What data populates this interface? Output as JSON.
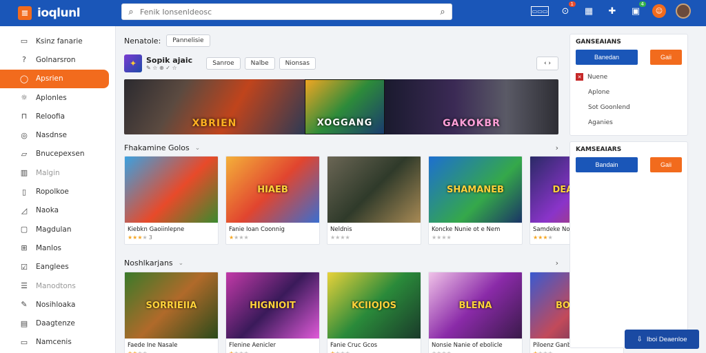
{
  "header": {
    "logo_text": "ioqlunl",
    "search_placeholder": "Fenik Ionsenldeosc",
    "box_label": "▭▭▭",
    "badge_bell": "1",
    "badge_chat": "4"
  },
  "sidebar": {
    "items": [
      {
        "label": "Ksinz fanarie",
        "icon": "map-icon"
      },
      {
        "label": "Golnarsron",
        "icon": "question-icon"
      },
      {
        "label": "Apsrien",
        "icon": "circle-icon"
      },
      {
        "label": "Aplonles",
        "icon": "sun-icon"
      },
      {
        "label": "Reloofia",
        "icon": "bag-icon"
      },
      {
        "label": "Nasdnse",
        "icon": "eye-icon"
      },
      {
        "label": "Bnucepexsen",
        "icon": "tag-icon"
      },
      {
        "label": "Malgin",
        "icon": "grid-icon"
      },
      {
        "label": "Ropolkoe",
        "icon": "doc-icon"
      },
      {
        "label": "Naoka",
        "icon": "chart-icon"
      },
      {
        "label": "Magdulan",
        "icon": "box-icon"
      },
      {
        "label": "Manlos",
        "icon": "table-icon"
      },
      {
        "label": "Eanglees",
        "icon": "check-icon"
      },
      {
        "label": "Manodtons",
        "icon": "list-icon"
      },
      {
        "label": "Nosihloaka",
        "icon": "edit-icon"
      },
      {
        "label": "Daagtenze",
        "icon": "calendar-icon"
      },
      {
        "label": "Namcenis",
        "icon": "folder-icon"
      }
    ]
  },
  "filter": {
    "label": "Nenatole:",
    "chip": "Pannelisie"
  },
  "store": {
    "name": "Sopik ajaic",
    "sub": "✎ ☆ ⊕ ✓ ☆",
    "chips": [
      "Sanroe",
      "Nalbe",
      "Nionsas"
    ],
    "nav": "‹ ›"
  },
  "hero": {
    "panels": [
      "XBRIEN",
      "XOGGANG",
      "GAKOKBR"
    ]
  },
  "section1": {
    "title": "Fhakamine Golos",
    "caret": "⌄",
    "more": "›",
    "cards": [
      {
        "thumb": "",
        "title": "Kiebkn Gaoiinlepne",
        "stars": 3,
        "num": "3"
      },
      {
        "thumb": "HIAEB",
        "title": "Fanie Ioan Coonnig",
        "stars": 1,
        "num": ""
      },
      {
        "thumb": "",
        "title": "Neldnis",
        "stars": 0,
        "num": ""
      },
      {
        "thumb": "SHAMANEB",
        "title": "Koncke Nunie ot e Nem",
        "stars": 0,
        "num": ""
      },
      {
        "thumb": "DEARCAG",
        "title": "Samdeke Nosos",
        "stars": 3,
        "num": ""
      }
    ]
  },
  "section2": {
    "title": "Noshlkarjans",
    "caret": "⌄",
    "more": "›",
    "cards": [
      {
        "thumb": "SORRIEIIA",
        "title": "Faede Ine Nasale",
        "stars": 0,
        "num": ""
      },
      {
        "thumb": "HIGNIOIT",
        "title": "Flenine Aenicler",
        "stars": 0,
        "num": ""
      },
      {
        "thumb": "KCIIOJOS",
        "title": "Fanie Cruc Gcos",
        "stars": 0,
        "num": ""
      },
      {
        "thumb": "BLENA",
        "title": "Nonsie Nanie of ebolicle",
        "stars": 0,
        "num": ""
      },
      {
        "thumb": "BOSSLIE",
        "title": "Piloenz Ganbra Rosnils",
        "stars": 0,
        "num": ""
      }
    ]
  },
  "rpanel1": {
    "title": "GANSEAIANS",
    "btn_primary": "Banedan",
    "btn_secondary": "Gaii",
    "lines": [
      "Nuene",
      "Aplone",
      "Sot Goonlend",
      "Aganies"
    ]
  },
  "rpanel2": {
    "title": "KAMSEAIARS",
    "btn_primary": "Bandain",
    "btn_secondary": "Gaii"
  },
  "fab": {
    "label": "Iboi Deaenloe"
  }
}
